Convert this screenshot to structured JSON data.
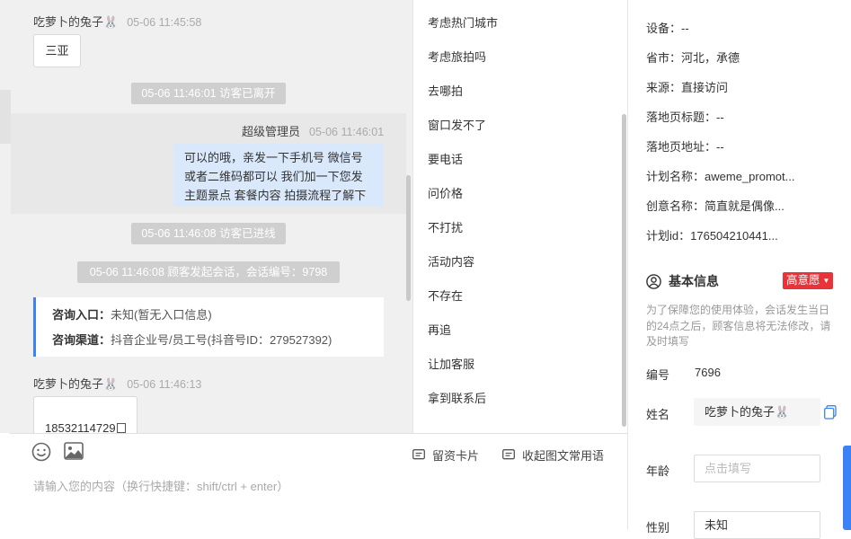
{
  "chat": {
    "messages": [
      {
        "sender": "吃萝卜的兔子🐰",
        "time": "05-06 11:45:58",
        "text": "三亚"
      },
      {
        "system": "05-06 11:46:01 访客已离开"
      },
      {
        "sender": "超级管理员",
        "time": "05-06 11:46:01",
        "lines": [
          "可以的哦，亲发一下手机号 微信号",
          "或者二维码都可以 我们加一下您发",
          "主题景点 套餐内容 拍摄流程了解下"
        ]
      },
      {
        "system": "05-06 11:46:08 访客已进线"
      },
      {
        "system": "05-06 11:46:08 顾客发起会话，会话编号：9798"
      },
      {
        "sender": "吃萝卜的兔子🐰",
        "time": "05-06 11:46:13",
        "text": "18532114729"
      }
    ],
    "card": {
      "entry_label": "咨询入口：",
      "entry_value": "未知(暂无入口信息)",
      "channel_label": "咨询渠道：",
      "channel_value": "抖音企业号/员工号(抖音号ID：279527392)"
    }
  },
  "phrases": [
    "考虑热门城市",
    "考虑旅拍吗",
    "去哪拍",
    "窗口发不了",
    "要电话",
    "问价格",
    "不打扰",
    "活动内容",
    "不存在",
    "再追",
    "让加客服",
    "拿到联系后"
  ],
  "input": {
    "lead_card": "留资卡片",
    "collapse": "收起图文常用语",
    "placeholder": "请输入您的内容（换行快捷键：shift/ctrl + enter）"
  },
  "info": {
    "rows": [
      {
        "k": "设备：",
        "v": "--"
      },
      {
        "k": "省市：",
        "v": "河北，承德"
      },
      {
        "k": "来源：",
        "v": "直接访问"
      },
      {
        "k": "落地页标题：",
        "v": "--"
      },
      {
        "k": "落地页地址：",
        "v": "--"
      },
      {
        "k": "计划名称：",
        "v": "aweme_promot..."
      },
      {
        "k": "创意名称：",
        "v": "简直就是偶像..."
      },
      {
        "k": "计划id：",
        "v": "176504210441..."
      }
    ],
    "basic_title": "基本信息",
    "intent_tag": "高意愿",
    "notice": "为了保障您的使用体验，会话发生当日的24点之后，顾客信息将无法修改，请及时填写",
    "id_label": "编号",
    "id_value": "7696",
    "name_label": "姓名",
    "name_value": "吃萝卜的兔子🐰",
    "age_label": "年龄",
    "age_placeholder": "点击填写",
    "gender_label": "性别",
    "gender_value": "未知"
  },
  "colors": {
    "accent": "#3b82f6",
    "tag": "#e8333a",
    "bubble": "#d9e8fb"
  }
}
